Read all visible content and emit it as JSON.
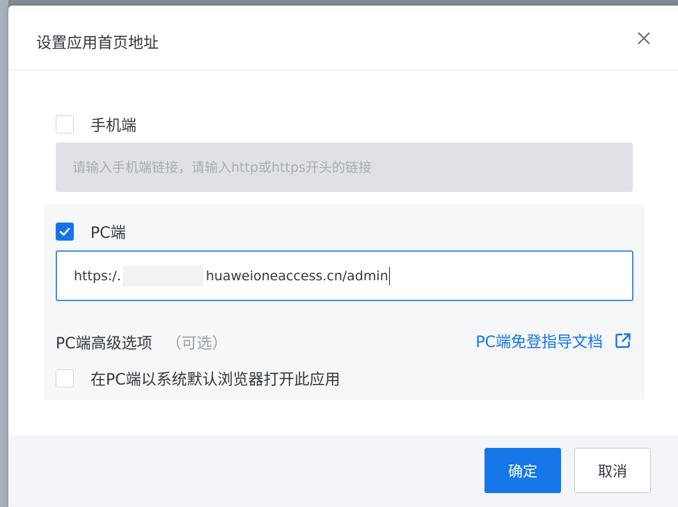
{
  "dialog": {
    "title": "设置应用首页地址",
    "close_icon": "close-icon"
  },
  "mobile": {
    "label": "手机端",
    "checked": false,
    "input_value": "",
    "input_placeholder": "请输入手机端链接，请输入http或https开头的链接"
  },
  "pc": {
    "label": "PC端",
    "checked": true,
    "url_prefix": "https:/.",
    "url_suffix": "huaweioneaccess.cn/admin"
  },
  "advanced": {
    "title": "PC端高级选项",
    "optional": "（可选）",
    "guide_link": "PC端免登指导文档",
    "guide_icon": "external-link-icon",
    "open_in_browser_label": "在PC端以系统默认浏览器打开此应用",
    "open_in_browser_checked": false
  },
  "footer": {
    "confirm_label": "确定",
    "cancel_label": "取消"
  },
  "colors": {
    "accent": "#1475ea",
    "footer_bg": "#f3f5f8",
    "panel_bg": "#f6f7f9"
  }
}
